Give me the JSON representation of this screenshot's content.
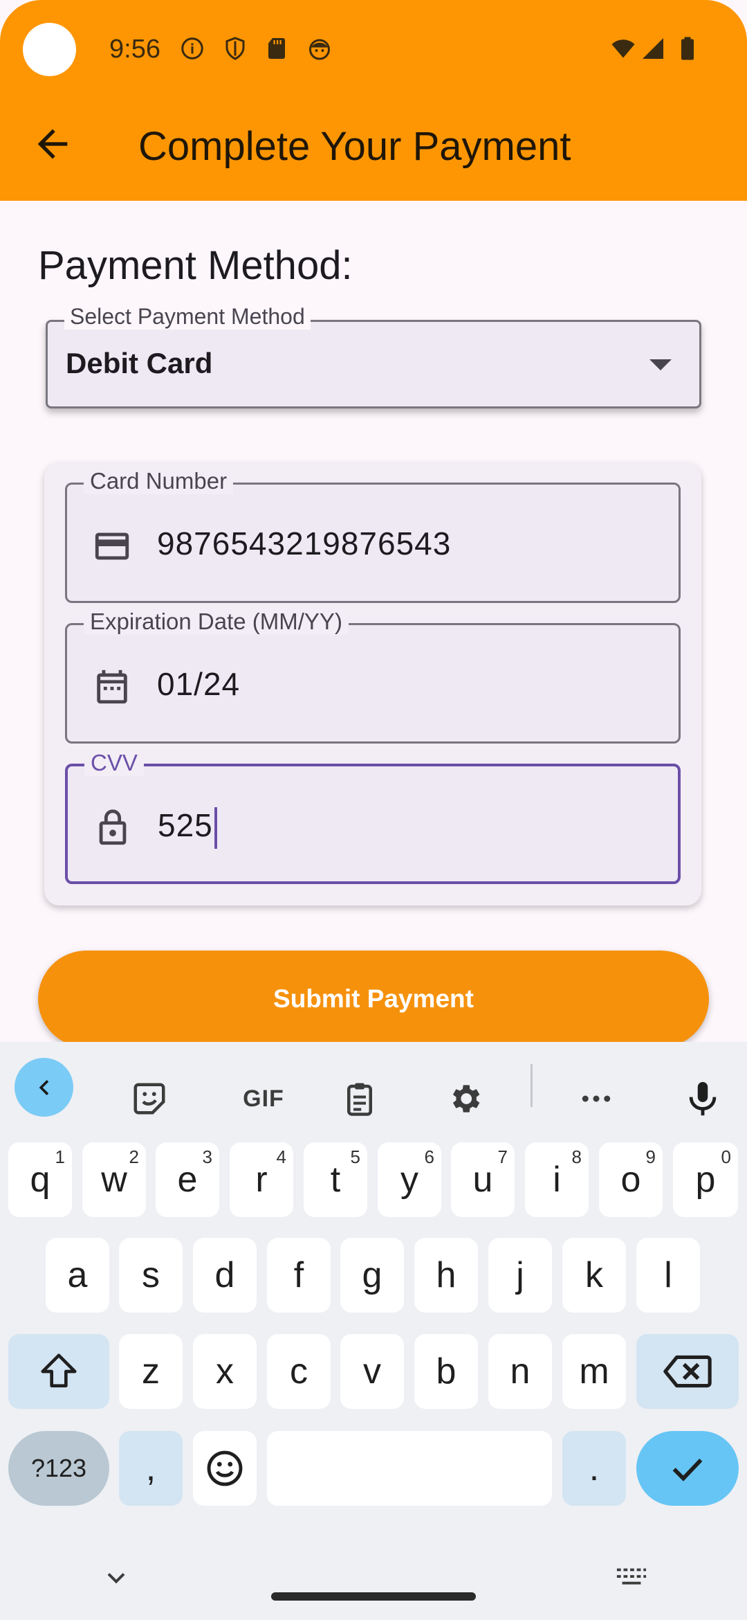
{
  "status_bar": {
    "time": "9:56"
  },
  "app_bar": {
    "title": "Complete Your Payment"
  },
  "section_title": "Payment Method:",
  "payment_method": {
    "label": "Select Payment Method",
    "value": "Debit Card"
  },
  "card_form": {
    "card_number": {
      "label": "Card Number",
      "value": "9876543219876543",
      "icon": "credit-card-icon"
    },
    "expiry": {
      "label": "Expiration Date (MM/YY)",
      "value": "01/24",
      "icon": "calendar-icon"
    },
    "cvv": {
      "label": "CVV",
      "value": "525",
      "icon": "lock-icon"
    }
  },
  "submit_label": "Submit Payment",
  "keyboard": {
    "gif_label": "GIF",
    "row1": [
      "q",
      "w",
      "e",
      "r",
      "t",
      "y",
      "u",
      "i",
      "o",
      "p"
    ],
    "row1_hints": [
      "1",
      "2",
      "3",
      "4",
      "5",
      "6",
      "7",
      "8",
      "9",
      "0"
    ],
    "row2": [
      "a",
      "s",
      "d",
      "f",
      "g",
      "h",
      "j",
      "k",
      "l"
    ],
    "row3": [
      "z",
      "x",
      "c",
      "v",
      "b",
      "n",
      "m"
    ],
    "symbols_label": "?123",
    "comma": ",",
    "period": "."
  },
  "colors": {
    "app_bar": "#fd9602",
    "submit": "#f6910c",
    "focus": "#6a4fa8"
  }
}
